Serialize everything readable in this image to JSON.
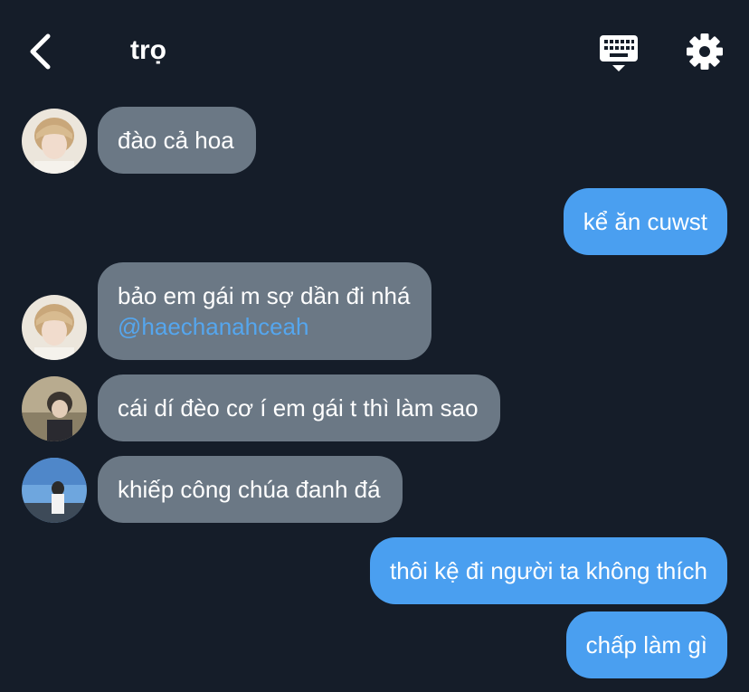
{
  "header": {
    "title": "trọ"
  },
  "icons": {
    "back": "chevron-left-icon",
    "keyboard": "keyboard-icon",
    "settings": "gear-icon"
  },
  "colors": {
    "background": "#151d29",
    "incoming_bubble": "#6b7885",
    "outgoing_bubble": "#4a9ff0",
    "mention": "#55a6ee"
  },
  "messages": [
    {
      "direction": "incoming",
      "avatar": "avatar-1",
      "text": "đào cả hoa"
    },
    {
      "direction": "outgoing",
      "text": "kể ăn cuwst"
    },
    {
      "direction": "incoming",
      "avatar": "avatar-1",
      "text": "bảo em gái m sợ dần đi nhá",
      "mention": "@haechanahceah"
    },
    {
      "direction": "incoming",
      "avatar": "avatar-2",
      "text": "cái dí đèo cơ í em gái t thì làm sao"
    },
    {
      "direction": "incoming",
      "avatar": "avatar-3",
      "text": "khiếp công chúa đanh đá"
    },
    {
      "direction": "outgoing",
      "text": "thôi kệ đi người ta không thích"
    },
    {
      "direction": "outgoing",
      "text": "chấp làm gì"
    }
  ]
}
